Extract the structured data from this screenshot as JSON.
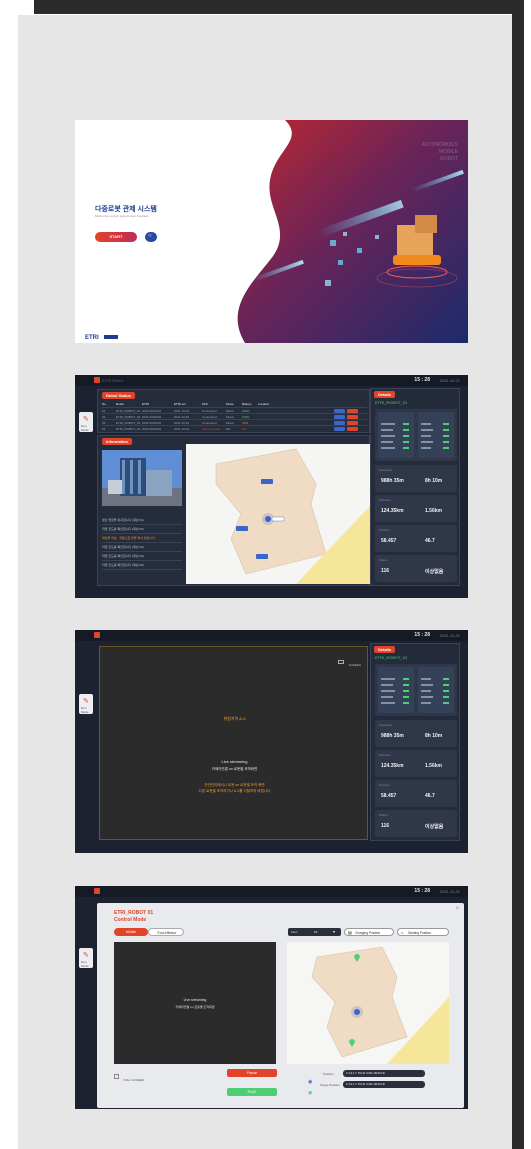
{
  "slide1": {
    "title": "다중로봇 관제 시스템",
    "subtitle": "Multi-robot control system user interface",
    "start_label": "START",
    "tagline": [
      "AUTONOMOUS",
      "MOBILE",
      "ROBOT"
    ],
    "logo_text": "ETRI"
  },
  "slide2": {
    "brand": "ETRI Robot",
    "clock": "15 : 28",
    "date": "2021.10.21",
    "robot_status_tab": "Robot Status",
    "information_tab": "Information",
    "details_tab": "Details",
    "robot_id": "ETRI_ROBOT_01",
    "side_button": "Run Mode",
    "table_headers": [
      "No.",
      "Robot",
      "ETRI",
      "ETRI set",
      "PAS",
      "Mode",
      "Battery",
      "Location"
    ],
    "table_rows": [
      [
        "01",
        "ETRI_ROBOT_01",
        "2021/10/20/01",
        "2021.10.20",
        "Connected",
        "Moral",
        "100%"
      ],
      [
        "02",
        "ETRI_ROBOT_02",
        "2021/10/20/01",
        "2021.10.20",
        "Connected",
        "Moral",
        "100%"
      ],
      [
        "03",
        "ETRI_ROBOT_03",
        "2021/10/20/01",
        "2021.10.20",
        "Connected",
        "Moral",
        "70%"
      ],
      [
        "04",
        "ETRI_ROBOT_04",
        "2021/10/20/01",
        "2021.10.20",
        "Disconnected",
        "Mix",
        "5%"
      ]
    ],
    "log_items": [
      "생산 현장을 유지합니다 (대상 01)",
      "작업 진도를 확인합니다 (대상 02)",
      "대상을 지날 - 자동으로 불을 켜서 닫습니다",
      "작업 진도를 확인합니다 (대상 03)",
      "작업 진도를 확인합니다 (대상 04)",
      "작업 진도를 확인합니다 (대상 05)"
    ],
    "stats": [
      {
        "label": "Operation",
        "a": "988h 35m",
        "b": "8h 10m"
      },
      {
        "label": "Distance",
        "a": "124.35km",
        "b": "1.56km"
      },
      {
        "label": "Position",
        "a": "58.457",
        "b": "46.7"
      },
      {
        "label": "Status",
        "a": "116",
        "b": "이상없음"
      }
    ]
  },
  "slide3": {
    "clock": "15 : 28",
    "date": "2021.10.21",
    "details_tab": "Details",
    "robot_id": "ETRI_ROBOT_01",
    "screen_btn": "SCREEN",
    "warn1": "위험지역 A-3",
    "live": "Live streaming",
    "camera": "카메라연결 on 로봇별 조작화면",
    "warn2a": "안전관리에서나 로봇 on 로봇별 조작 화면",
    "warn2b": "다른 로봇을 조작하거나 A-3를 이탈하여 바랍니다",
    "side_button": "Run Mode",
    "stats": [
      {
        "label": "Operation",
        "a": "988h 35m",
        "b": "8h 10m"
      },
      {
        "label": "Distance",
        "a": "124.35km",
        "b": "1.56km"
      },
      {
        "label": "Position",
        "a": "58.457",
        "b": "46.7"
      },
      {
        "label": "Status",
        "a": "116",
        "b": "이상없음"
      }
    ]
  },
  "slide4": {
    "clock": "15 : 28",
    "date": "2021.10.21",
    "robot_name": "ETRI_ROBOT 01",
    "mode_title": "Control Mode",
    "tab_mobile": "Mobile",
    "tab_effector": "End-effector",
    "floor_label": "Floor",
    "floor_value": "1F",
    "charging_btn": "Charging Position",
    "starting_btn": "Starting Position",
    "live": "Live streaming",
    "camera": "카메라연결 on 로봇별 조작화면",
    "fullscreen": "FULL SCREEN",
    "pause_btn": "Pause",
    "play_btn": "PLAY",
    "position_label": "Position",
    "target_label": "Target Position",
    "position_value": "X: 12.1  Y: 45  Lift: 0  Rot: 00.00 Lift",
    "target_value": "X: 12.1  Y: 45  Lift: 0  Rot: 00.00 Lift",
    "side_button": "Run Mode"
  },
  "colors": {
    "accent": "#e2442a",
    "dark_bg": "#1c2230",
    "panel": "#252c3b",
    "green": "#4fcf73",
    "orange": "#f29a2e"
  }
}
